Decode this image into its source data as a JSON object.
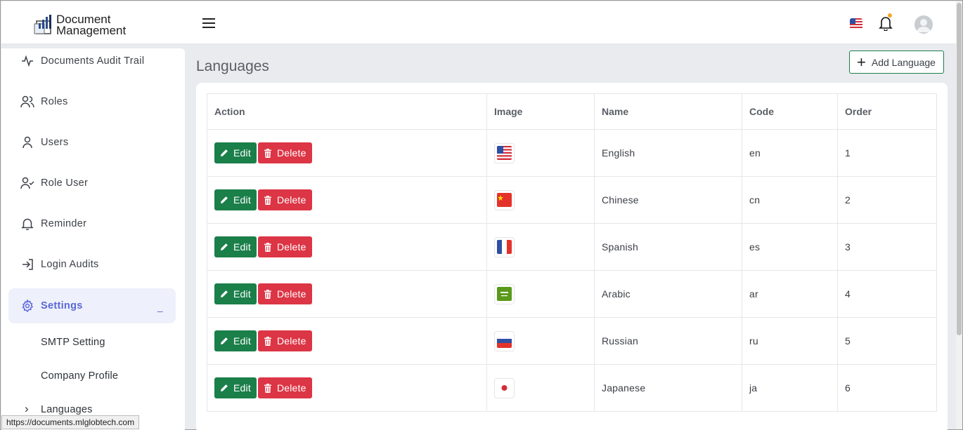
{
  "app": {
    "logo_line1": "Document",
    "logo_line2": "Management"
  },
  "sidebar": {
    "items": [
      {
        "label": "Documents Audit Trail",
        "icon": "activity-icon"
      },
      {
        "label": "Roles",
        "icon": "users-icon"
      },
      {
        "label": "Users",
        "icon": "user-icon"
      },
      {
        "label": "Role User",
        "icon": "user-check-icon"
      },
      {
        "label": "Reminder",
        "icon": "bell-icon"
      },
      {
        "label": "Login Audits",
        "icon": "login-icon"
      },
      {
        "label": "Settings",
        "icon": "gear-icon",
        "active": true,
        "collapse_glyph": "_"
      }
    ],
    "sub_items": [
      {
        "label": "SMTP Setting"
      },
      {
        "label": "Company Profile"
      },
      {
        "label": "Languages",
        "current": true
      }
    ]
  },
  "page": {
    "title": "Languages",
    "add_button": "Add Language"
  },
  "table": {
    "headers": [
      "Action",
      "Image",
      "Name",
      "Code",
      "Order"
    ],
    "edit_label": "Edit",
    "delete_label": "Delete",
    "rows": [
      {
        "flag": "us",
        "name": "English",
        "code": "en",
        "order": "1"
      },
      {
        "flag": "cn",
        "name": "Chinese",
        "code": "cn",
        "order": "2"
      },
      {
        "flag": "fr",
        "name": "Spanish",
        "code": "es",
        "order": "3"
      },
      {
        "flag": "sa",
        "name": "Arabic",
        "code": "ar",
        "order": "4"
      },
      {
        "flag": "ru",
        "name": "Russian",
        "code": "ru",
        "order": "5"
      },
      {
        "flag": "jp",
        "name": "Japanese",
        "code": "ja",
        "order": "6"
      }
    ]
  },
  "status_bar": {
    "url": "https://documents.mlglobtech.com"
  },
  "colors": {
    "primary_green": "#1b7f4a",
    "danger_red": "#dc3545",
    "accent_indigo": "#5a67d8",
    "notification_dot": "#f5a623"
  }
}
